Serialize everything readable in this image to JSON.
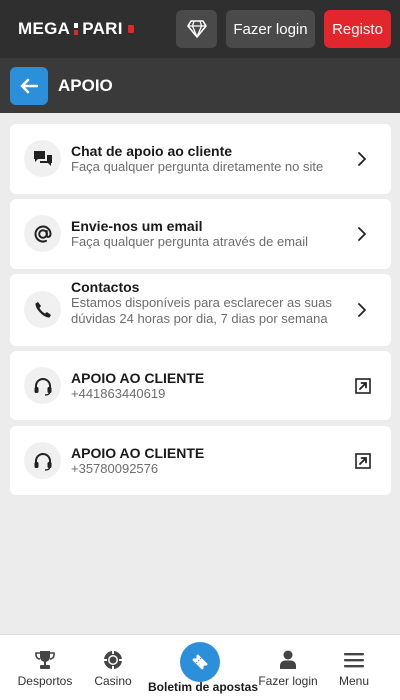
{
  "header": {
    "logo_left": "MEGA",
    "logo_right": "PARI",
    "login_label": "Fazer login",
    "register_label": "Registo"
  },
  "page": {
    "title": "APOIO"
  },
  "support_items": [
    {
      "title": "Chat de apoio ao cliente",
      "subtitle": "Faça qualquer pergunta diretamente no site",
      "icon": "chat-icon"
    },
    {
      "title": "Envie-nos um email",
      "subtitle": "Faça qualquer pergunta através de email",
      "icon": "at-icon"
    },
    {
      "title": "Contactos",
      "subtitle": "Estamos disponíveis para esclarecer as suas dúvidas 24 horas por dia, 7 dias por semana",
      "icon": "phone-icon"
    },
    {
      "title": "APOIO AO CLIENTE",
      "subtitle": "+441863440619",
      "icon": "headset-icon"
    },
    {
      "title": "APOIO AO CLIENTE",
      "subtitle": "+35780092576",
      "icon": "headset-icon"
    }
  ],
  "bottom_nav": {
    "sports": "Desportos",
    "casino": "Casino",
    "betslip": "Boletim de apostas",
    "login": "Fazer login",
    "menu": "Menu"
  },
  "colors": {
    "accent": "#2c8fd9",
    "brand_red": "#e2262b",
    "header_bg": "#2f2f2f"
  }
}
